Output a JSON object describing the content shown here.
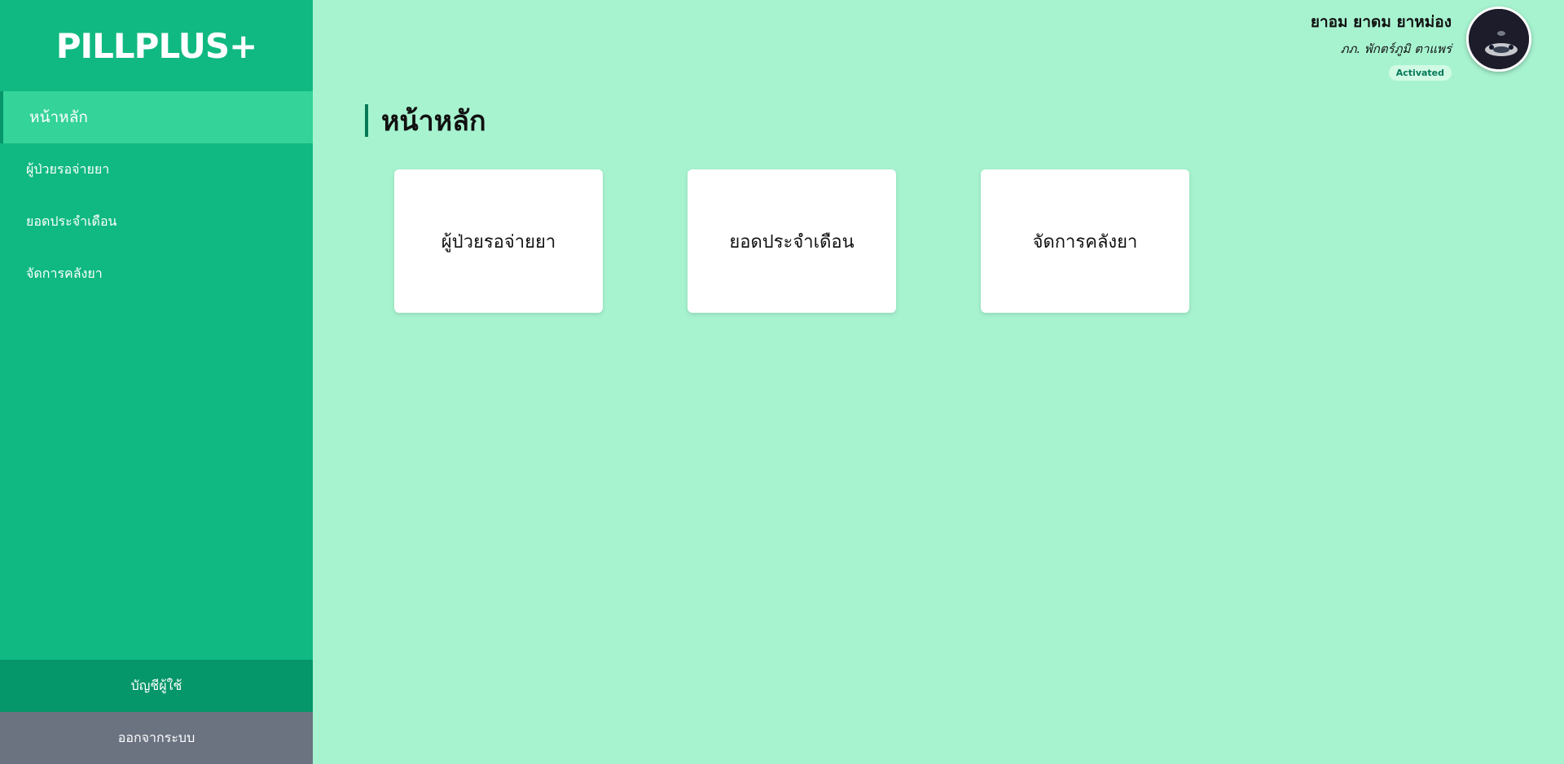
{
  "brand": {
    "name": "PILLPLUS+"
  },
  "sidebar": {
    "items": [
      {
        "label": "หน้าหลัก",
        "active": true
      },
      {
        "label": "ผู้ป่วยรอจ่ายยา",
        "active": false
      },
      {
        "label": "ยอดประจำเดือน",
        "active": false
      },
      {
        "label": "จัดการคลังยา",
        "active": false
      }
    ],
    "account_label": "บัญชีผู้ใช้",
    "logout_label": "ออกจากระบบ"
  },
  "user": {
    "name": "ยาอม ยาดม ยาหม่อง",
    "title": "ภภ. พักตร์ภูมิ ตาแพร่",
    "status": "Activated"
  },
  "main": {
    "page_title": "หน้าหลัก",
    "cards": [
      {
        "label": "ผู้ป่วยรอจ่ายยา"
      },
      {
        "label": "ยอดประจำเดือน"
      },
      {
        "label": "จัดการคลังยา"
      }
    ]
  },
  "colors": {
    "sidebar": "#10b981",
    "sidebar_active": "#34d399",
    "account_button": "#059669",
    "logout_button": "#6b7280",
    "main_background": "#a7f3d0",
    "accent": "#047857"
  }
}
